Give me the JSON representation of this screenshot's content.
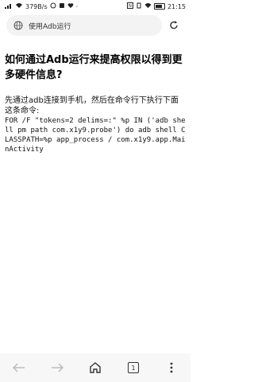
{
  "status_bar": {
    "network_speed": "379B/s",
    "time": "21:15"
  },
  "url_bar": {
    "text": "使用Adb运行"
  },
  "article": {
    "title": "如何通过Adb运行来提高权限以得到更多硬件信息?",
    "intro": "先通过adb连接到手机，然后在命令行下执行下面这条命令:",
    "code": "FOR /F \"tokens=2 delims=:\" %p IN ('adb shell pm path com.x1y9.probe') do adb shell CLASSPATH=%p app_process / com.x1y9.app.MainActivity"
  },
  "bottom_nav": {
    "tab_count": "1"
  },
  "icons": {
    "url": "globe-icon",
    "reload": "reload-icon",
    "back": "back-arrow-icon",
    "forward": "forward-arrow-icon",
    "home": "home-icon",
    "tabs": "tabs-icon",
    "menu": "more-vert-icon"
  }
}
